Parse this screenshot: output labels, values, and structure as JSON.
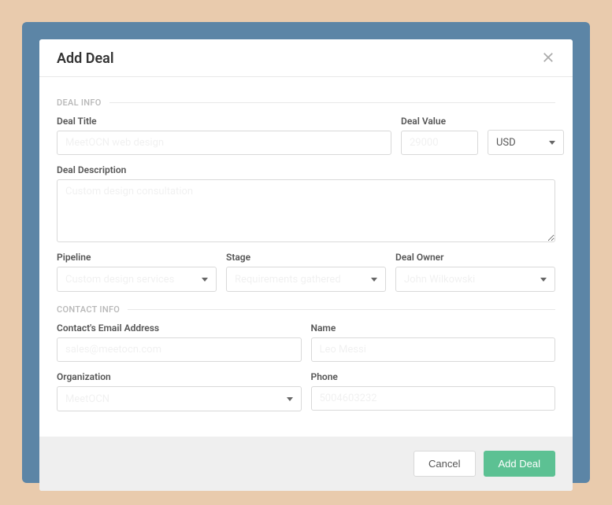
{
  "modal": {
    "title": "Add Deal"
  },
  "sections": {
    "deal_info": "DEAL INFO",
    "contact_info": "CONTACT INFO"
  },
  "labels": {
    "deal_title": "Deal Title",
    "deal_value": "Deal Value",
    "deal_description": "Deal Description",
    "pipeline": "Pipeline",
    "stage": "Stage",
    "deal_owner": "Deal Owner",
    "contact_email": "Contact's Email Address",
    "name": "Name",
    "organization": "Organization",
    "phone": "Phone"
  },
  "fields": {
    "deal_title": {
      "value": "",
      "placeholder": "MeetOCN web design"
    },
    "deal_value": {
      "value": "",
      "placeholder": "29000"
    },
    "currency": {
      "value": "USD"
    },
    "deal_description": {
      "value": "",
      "placeholder": "Custom design consultation"
    },
    "pipeline": {
      "value": "Custom design services"
    },
    "stage": {
      "value": "Requirements gathered"
    },
    "deal_owner": {
      "value": "John Wilkowski"
    },
    "contact_email": {
      "value": "",
      "placeholder": "sales@meetocn.com"
    },
    "name": {
      "value": "",
      "placeholder": "Leo Messi"
    },
    "organization": {
      "value": "MeetOCN"
    },
    "phone": {
      "value": "",
      "placeholder": "5004603232"
    }
  },
  "buttons": {
    "cancel": "Cancel",
    "submit": "Add Deal"
  }
}
